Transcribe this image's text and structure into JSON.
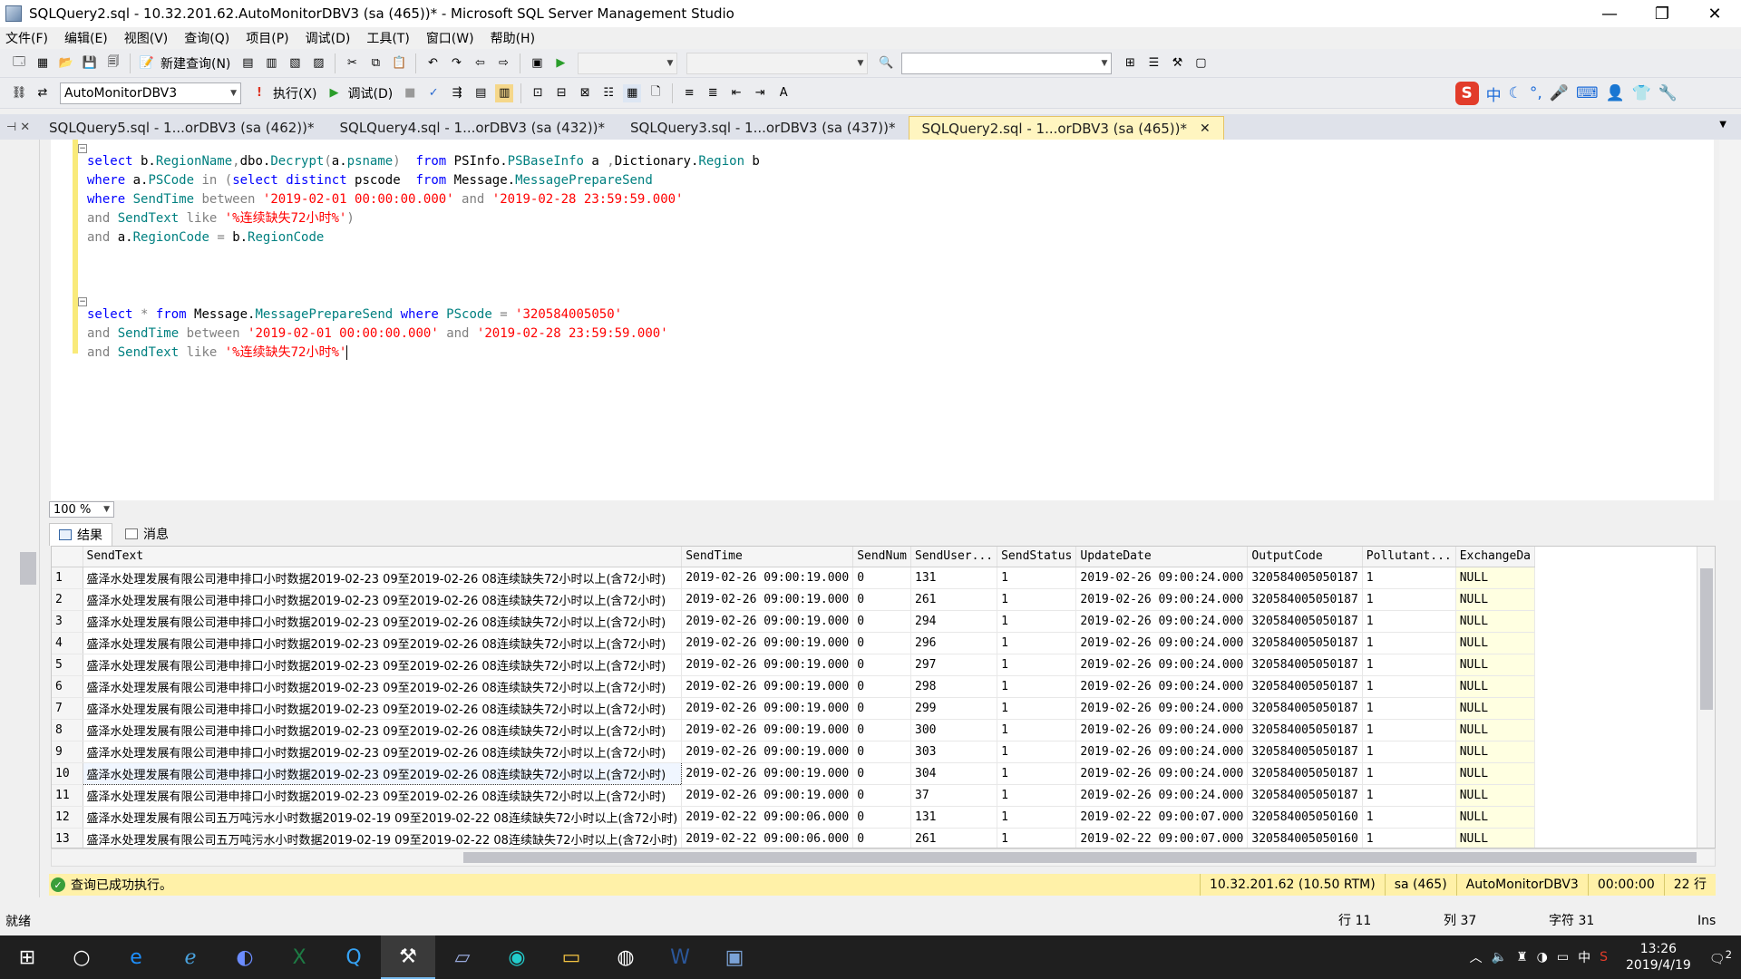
{
  "window": {
    "title": "SQLQuery2.sql - 10.32.201.62.AutoMonitorDBV3 (sa (465))* - Microsoft SQL Server Management Studio",
    "minimize": "—",
    "restore": "❐",
    "close": "✕"
  },
  "menu": [
    "文件(F)",
    "编辑(E)",
    "视图(V)",
    "查询(Q)",
    "项目(P)",
    "调试(D)",
    "工具(T)",
    "窗口(W)",
    "帮助(H)"
  ],
  "toolbar1": {
    "new_query": "新建查询(N)"
  },
  "toolbar2": {
    "database": "AutoMonitorDBV3",
    "execute": "执行(X)",
    "debug": "调试(D)"
  },
  "tabs": [
    {
      "label": "SQLQuery5.sql - 1...orDBV3 (sa (462))*"
    },
    {
      "label": "SQLQuery4.sql - 1...orDBV3 (sa (432))*"
    },
    {
      "label": "SQLQuery3.sql - 1...orDBV3 (sa (437))*"
    },
    {
      "label": "SQLQuery2.sql - 1...orDBV3 (sa (465))*"
    }
  ],
  "editor": {
    "zoom": "100 %",
    "code": {
      "l1": {
        "k1": "select",
        "a": " b.",
        "b": "RegionName",
        "c": ",",
        "d": "dbo.",
        "e": "Decrypt",
        "f": "(",
        "g": "a.",
        "h": "psname",
        "i": ")  ",
        "k2": "from",
        "j": " PSInfo.",
        "m": "PSBaseInfo",
        "n": " a ",
        "o": ",",
        "p": "Dictionary.",
        "q": "Region",
        "r": " b"
      },
      "l2": {
        "k1": "where",
        "a": " a.",
        "b": "PSCode",
        "c": " in ",
        "d": "(",
        "k2": "select distinct",
        "e": " pscode  ",
        "k3": "from",
        "f": " Message.",
        "g": "MessagePrepareSend"
      },
      "l3": {
        "k1": "where",
        "a": " SendTime ",
        "b": "between",
        "s1": " '2019-02-01 00:00:00.000' ",
        "c": "and",
        "s2": " '2019-02-28 23:59:59.000'"
      },
      "l4": {
        "k1": "and",
        "a": " SendText ",
        "b": "like",
        "s1": " '%连续缺失72小时%'",
        "c": ")"
      },
      "l5": {
        "k1": "and",
        "a": " a.",
        "b": "RegionCode",
        "c": " = ",
        "d": "b.",
        "e": "RegionCode"
      },
      "l6": {
        "k1": "select",
        "a": " * ",
        "k2": "from",
        "b": " Message.",
        "c": "MessagePrepareSend",
        "k3": " where",
        "d": " PScode ",
        "e": "=",
        "s1": " '320584005050'"
      },
      "l7": {
        "k1": "and",
        "a": " SendTime ",
        "b": "between",
        "s1": " '2019-02-01 00:00:00.000' ",
        "c": "and",
        "s2": " '2019-02-28 23:59:59.000'"
      },
      "l8": {
        "k1": "and",
        "a": " SendText ",
        "b": "like",
        "s1": " '%连续缺失72小时%'"
      }
    }
  },
  "results": {
    "tab_results": "结果",
    "tab_messages": "消息",
    "columns": [
      "",
      "SendText",
      "SendTime",
      "SendNum",
      "SendUser...",
      "SendStatus",
      "UpdateDate",
      "OutputCode",
      "Pollutant...",
      "ExchangeDa"
    ],
    "rows": [
      [
        "1",
        "盛泽水处理发展有限公司港申排口小时数据2019-02-23 09至2019-02-26 08连续缺失72小时以上(含72小时)",
        "2019-02-26 09:00:19.000",
        "0",
        "131",
        "1",
        "2019-02-26 09:00:24.000",
        "320584005050187",
        "1",
        "NULL"
      ],
      [
        "2",
        "盛泽水处理发展有限公司港申排口小时数据2019-02-23 09至2019-02-26 08连续缺失72小时以上(含72小时)",
        "2019-02-26 09:00:19.000",
        "0",
        "261",
        "1",
        "2019-02-26 09:00:24.000",
        "320584005050187",
        "1",
        "NULL"
      ],
      [
        "3",
        "盛泽水处理发展有限公司港申排口小时数据2019-02-23 09至2019-02-26 08连续缺失72小时以上(含72小时)",
        "2019-02-26 09:00:19.000",
        "0",
        "294",
        "1",
        "2019-02-26 09:00:24.000",
        "320584005050187",
        "1",
        "NULL"
      ],
      [
        "4",
        "盛泽水处理发展有限公司港申排口小时数据2019-02-23 09至2019-02-26 08连续缺失72小时以上(含72小时)",
        "2019-02-26 09:00:19.000",
        "0",
        "296",
        "1",
        "2019-02-26 09:00:24.000",
        "320584005050187",
        "1",
        "NULL"
      ],
      [
        "5",
        "盛泽水处理发展有限公司港申排口小时数据2019-02-23 09至2019-02-26 08连续缺失72小时以上(含72小时)",
        "2019-02-26 09:00:19.000",
        "0",
        "297",
        "1",
        "2019-02-26 09:00:24.000",
        "320584005050187",
        "1",
        "NULL"
      ],
      [
        "6",
        "盛泽水处理发展有限公司港申排口小时数据2019-02-23 09至2019-02-26 08连续缺失72小时以上(含72小时)",
        "2019-02-26 09:00:19.000",
        "0",
        "298",
        "1",
        "2019-02-26 09:00:24.000",
        "320584005050187",
        "1",
        "NULL"
      ],
      [
        "7",
        "盛泽水处理发展有限公司港申排口小时数据2019-02-23 09至2019-02-26 08连续缺失72小时以上(含72小时)",
        "2019-02-26 09:00:19.000",
        "0",
        "299",
        "1",
        "2019-02-26 09:00:24.000",
        "320584005050187",
        "1",
        "NULL"
      ],
      [
        "8",
        "盛泽水处理发展有限公司港申排口小时数据2019-02-23 09至2019-02-26 08连续缺失72小时以上(含72小时)",
        "2019-02-26 09:00:19.000",
        "0",
        "300",
        "1",
        "2019-02-26 09:00:24.000",
        "320584005050187",
        "1",
        "NULL"
      ],
      [
        "9",
        "盛泽水处理发展有限公司港申排口小时数据2019-02-23 09至2019-02-26 08连续缺失72小时以上(含72小时)",
        "2019-02-26 09:00:19.000",
        "0",
        "303",
        "1",
        "2019-02-26 09:00:24.000",
        "320584005050187",
        "1",
        "NULL"
      ],
      [
        "10",
        "盛泽水处理发展有限公司港申排口小时数据2019-02-23 09至2019-02-26 08连续缺失72小时以上(含72小时)",
        "2019-02-26 09:00:19.000",
        "0",
        "304",
        "1",
        "2019-02-26 09:00:24.000",
        "320584005050187",
        "1",
        "NULL"
      ],
      [
        "11",
        "盛泽水处理发展有限公司港申排口小时数据2019-02-23 09至2019-02-26 08连续缺失72小时以上(含72小时)",
        "2019-02-26 09:00:19.000",
        "0",
        "37",
        "1",
        "2019-02-26 09:00:24.000",
        "320584005050187",
        "1",
        "NULL"
      ],
      [
        "12",
        "盛泽水处理发展有限公司五万吨污水小时数据2019-02-19 09至2019-02-22 08连续缺失72小时以上(含72小时)",
        "2019-02-22 09:00:06.000",
        "0",
        "131",
        "1",
        "2019-02-22 09:00:07.000",
        "320584005050160",
        "1",
        "NULL"
      ],
      [
        "13",
        "盛泽水处理发展有限公司五万吨污水小时数据2019-02-19 09至2019-02-22 08连续缺失72小时以上(含72小时)",
        "2019-02-22 09:00:06.000",
        "0",
        "261",
        "1",
        "2019-02-22 09:00:07.000",
        "320584005050160",
        "1",
        "NULL"
      ]
    ]
  },
  "query_status": {
    "message": "查询已成功执行。",
    "server": "10.32.201.62 (10.50 RTM)",
    "user": "sa (465)",
    "database": "AutoMonitorDBV3",
    "elapsed": "00:00:00",
    "rows": "22 行"
  },
  "statusbar": {
    "ready": "就绪",
    "line": "行 11",
    "col": "列 37",
    "char": "字符 31",
    "mode": "Ins"
  },
  "taskbar": {
    "time": "13:26",
    "date": "2019/4/19",
    "ime_lang": "中",
    "notifications": "2"
  },
  "colors": {
    "keyword": "#0000ff",
    "string": "#ff0000",
    "object": "#008080",
    "active_tab": "#fff5c0",
    "status_yellow": "#fff1a8"
  }
}
